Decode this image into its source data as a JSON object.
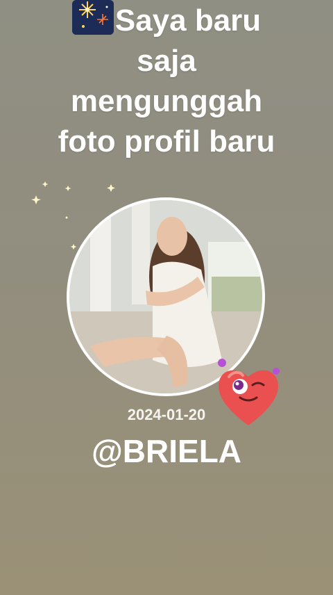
{
  "headline": {
    "line1": "Saya baru",
    "line2": "saja",
    "line3": "mengunggah",
    "line4": "foto profil baru",
    "emoji": "fireworks-icon"
  },
  "profile": {
    "date": "2024-01-20",
    "handle": "@BRIELA"
  },
  "decorations": {
    "sticker": "winking-heart-icon",
    "sparkles": "stars-icon"
  },
  "colors": {
    "background": "#928e7f",
    "text": "#ffffff",
    "heart": "#e9504f"
  }
}
